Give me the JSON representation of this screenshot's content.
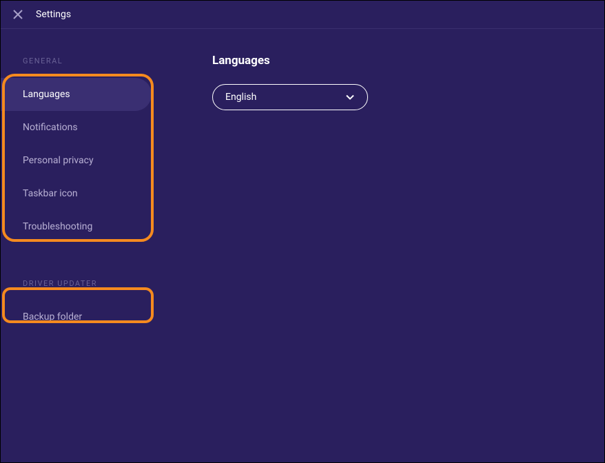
{
  "header": {
    "title": "Settings"
  },
  "sidebar": {
    "sections": [
      {
        "header": "GENERAL",
        "items": [
          {
            "label": "Languages",
            "active": true
          },
          {
            "label": "Notifications",
            "active": false
          },
          {
            "label": "Personal privacy",
            "active": false
          },
          {
            "label": "Taskbar icon",
            "active": false
          },
          {
            "label": "Troubleshooting",
            "active": false
          }
        ]
      },
      {
        "header": "DRIVER UPDATER",
        "items": [
          {
            "label": "Backup folder",
            "active": false
          }
        ]
      }
    ]
  },
  "main": {
    "title": "Languages",
    "dropdown": {
      "selected": "English"
    }
  }
}
